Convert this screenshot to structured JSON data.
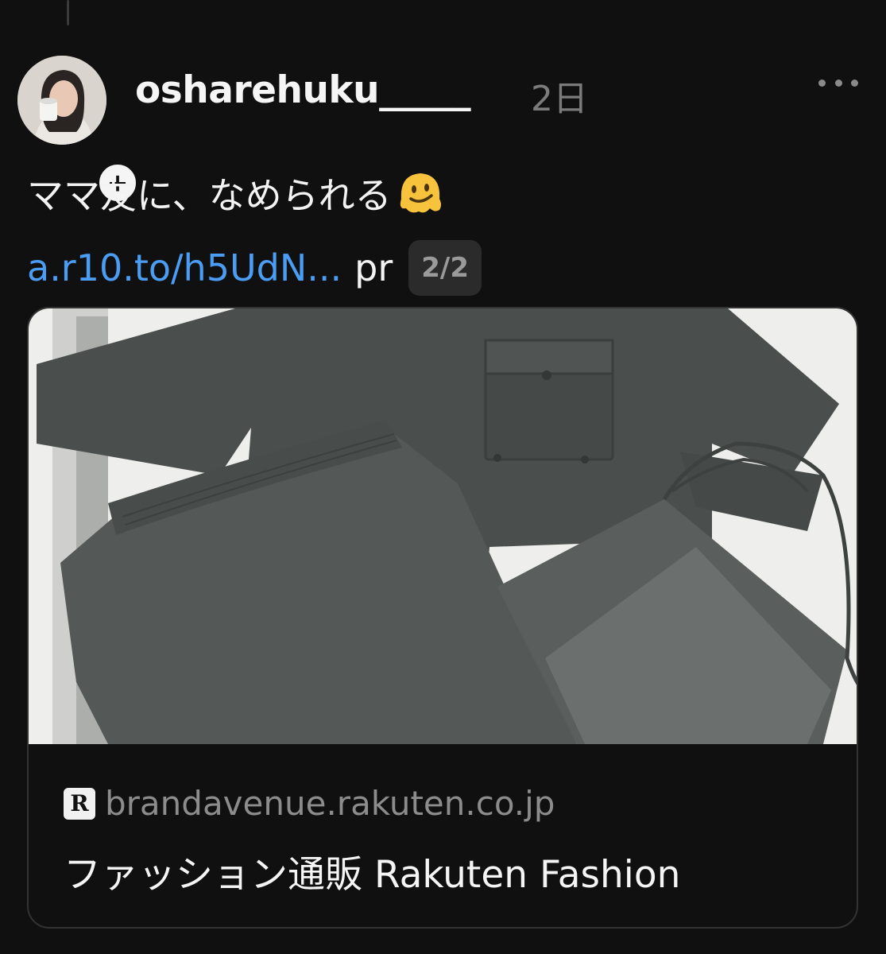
{
  "post": {
    "username": "osharehuku_____",
    "age": "2日",
    "text": "ママ友に、なめられる",
    "emoji": "melting-face-emoji",
    "link_text": "a.r10.to/h5UdN...",
    "suffix": "pr",
    "page_indicator": "2/2"
  },
  "link_card": {
    "domain": "brandavenue.rakuten.co.jp",
    "site_icon": "R",
    "title": "ファッション通販 Rakuten Fashion"
  },
  "colors": {
    "background": "#101010",
    "link": "#4a9df2",
    "muted": "#7b7b7b"
  }
}
